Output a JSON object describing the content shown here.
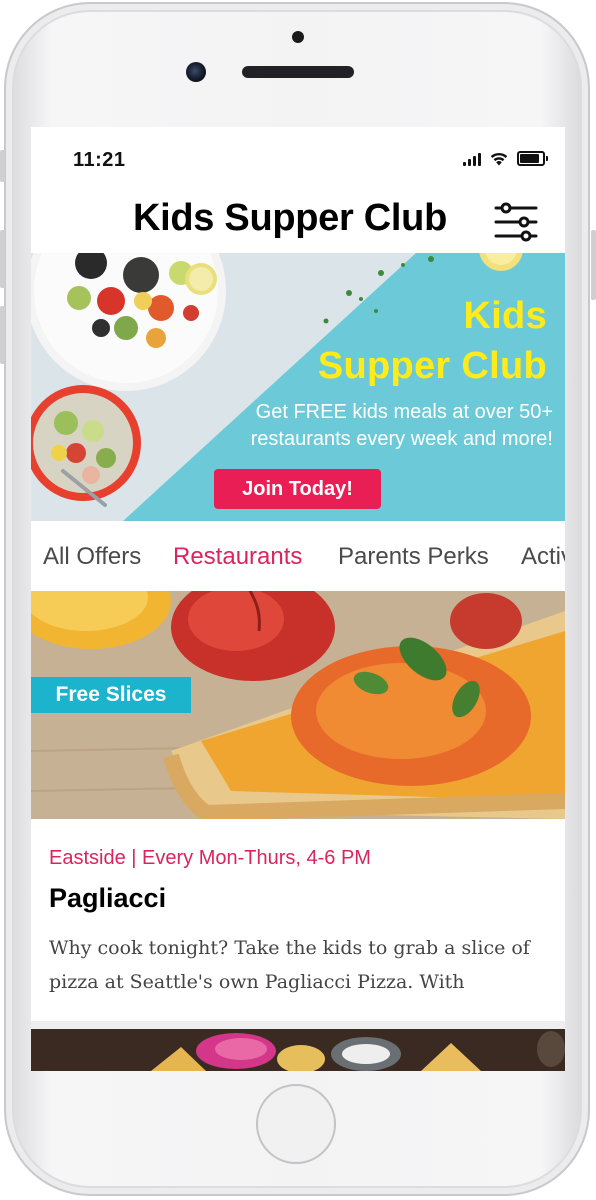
{
  "status_bar": {
    "time": "11:21",
    "signal_icon": "cellular-signal-icon",
    "wifi_icon": "wifi-icon",
    "battery_level": 0.85
  },
  "header": {
    "title": "Kids Supper Club",
    "filter_icon": "filter-sliders-icon"
  },
  "hero": {
    "title_line_1": "Kids",
    "title_line_2": "Supper Club",
    "description_line_1": "Get FREE kids meals at over 50+",
    "description_line_2": "restaurants every week and more!",
    "cta_label": "Join Today!",
    "colors": {
      "background": "#6ccad8",
      "title": "#ffeb1a",
      "cta": "#e81e55"
    }
  },
  "tabs": [
    {
      "label": "All Offers",
      "active": false
    },
    {
      "label": "Restaurants",
      "active": true
    },
    {
      "label": "Parents Perks",
      "active": false
    },
    {
      "label": "Activities",
      "active": false
    }
  ],
  "offer": {
    "tag": "Free Slices",
    "meta": "Eastside | Every Mon-Thurs, 4-6 PM",
    "title": "Pagliacci",
    "description": "Why cook tonight? Take the kids to grab a slice of pizza at Seattle's own Pagliacci Pizza. With"
  },
  "colors": {
    "accent": "#d9245e",
    "tag": "#1cb3cd"
  }
}
